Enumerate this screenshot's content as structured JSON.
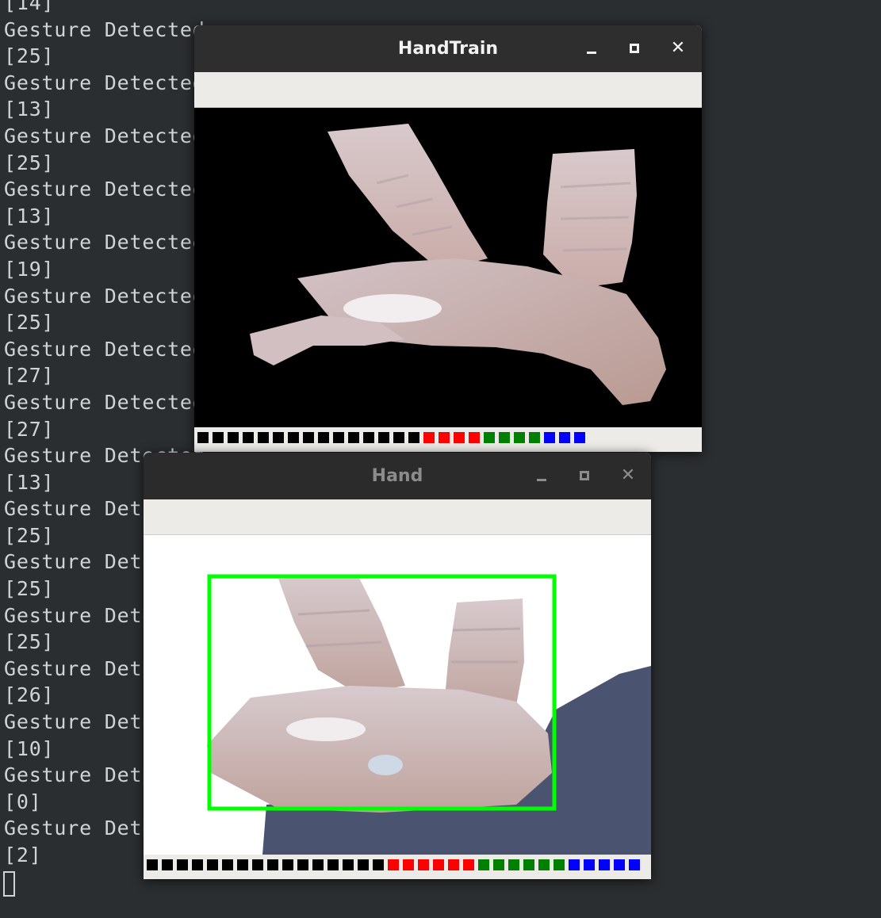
{
  "terminal": {
    "lines": [
      "[14]",
      "Gesture Detected",
      "[25]",
      "Gesture Detected",
      "[13]",
      "Gesture Detected",
      "[25]",
      "Gesture Detected",
      "[13]",
      "Gesture Detected",
      "[19]",
      "Gesture Detected",
      "[25]",
      "Gesture Detected",
      "[27]",
      "Gesture Detected",
      "[27]",
      "Gesture Detected",
      "[13]",
      "Gesture Detected",
      "[25]",
      "Gesture Detected",
      "[25]",
      "Gesture Detected",
      "[25]",
      "Gesture Detected",
      "[26]",
      "Gesture Detected",
      "[10]",
      "Gesture Detected",
      "[0]",
      "Gesture Detected",
      "[2]"
    ]
  },
  "windows": {
    "hand_train": {
      "title": "HandTrain",
      "minimize_label": "–",
      "close_label": "✕",
      "swatches": [
        "#000000",
        "#000000",
        "#000000",
        "#000000",
        "#000000",
        "#000000",
        "#000000",
        "#000000",
        "#000000",
        "#000000",
        "#000000",
        "#000000",
        "#000000",
        "#000000",
        "#000000",
        "#ff0000",
        "#ff0000",
        "#ff0000",
        "#ff0000",
        "#008000",
        "#008000",
        "#008000",
        "#008000",
        "#0000ff",
        "#0000ff",
        "#0000ff"
      ]
    },
    "hand": {
      "title": "Hand",
      "minimize_label": "–",
      "close_label": "✕",
      "swatches": [
        "#000000",
        "#000000",
        "#000000",
        "#000000",
        "#000000",
        "#000000",
        "#000000",
        "#000000",
        "#000000",
        "#000000",
        "#000000",
        "#000000",
        "#000000",
        "#000000",
        "#000000",
        "#000000",
        "#ff0000",
        "#ff0000",
        "#ff0000",
        "#ff0000",
        "#ff0000",
        "#ff0000",
        "#008000",
        "#008000",
        "#008000",
        "#008000",
        "#008000",
        "#008000",
        "#0000ff",
        "#0000ff",
        "#0000ff",
        "#0000ff",
        "#0000ff"
      ]
    }
  },
  "colors": {
    "terminal_bg": "#2b2e31",
    "terminal_text": "#d0d4d6",
    "bounding_box": "#00ff00",
    "skin": "#d9c5c6",
    "sleeve": "#4a5470"
  }
}
